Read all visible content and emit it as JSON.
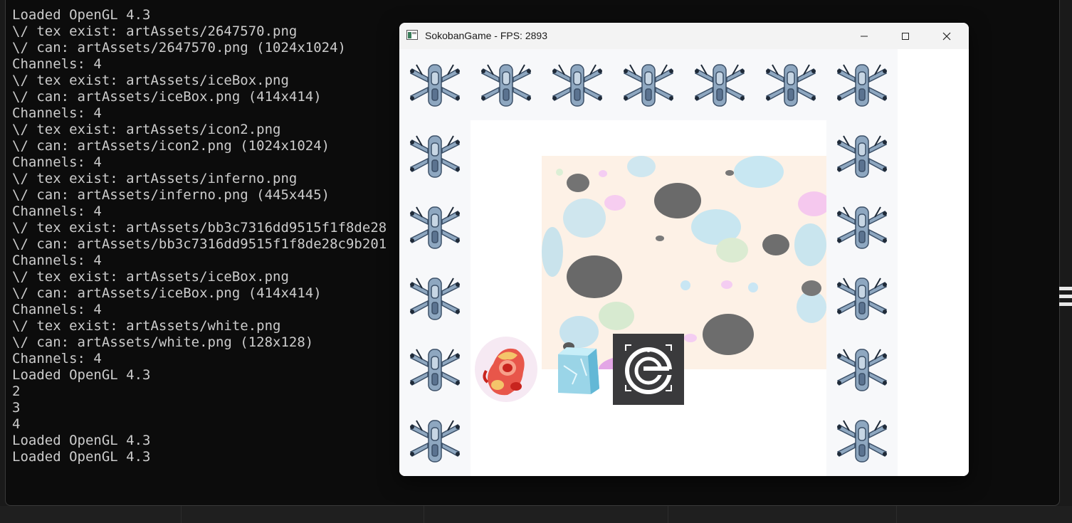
{
  "terminal": {
    "lines": [
      "Loaded OpenGL 4.3",
      "\\/ tex exist: artAssets/2647570.png",
      "\\/ can: artAssets/2647570.png (1024x1024)",
      "Channels: 4",
      "\\/ tex exist: artAssets/iceBox.png",
      "\\/ can: artAssets/iceBox.png (414x414)",
      "Channels: 4",
      "\\/ tex exist: artAssets/icon2.png",
      "\\/ can: artAssets/icon2.png (1024x1024)",
      "Channels: 4",
      "\\/ tex exist: artAssets/inferno.png",
      "\\/ can: artAssets/inferno.png (445x445)",
      "Channels: 4",
      "\\/ tex exist: artAssets/bb3c7316dd9515f1f8de28",
      "\\/ can: artAssets/bb3c7316dd9515f1f8de28c9b201",
      "Channels: 4",
      "\\/ tex exist: artAssets/iceBox.png",
      "\\/ can: artAssets/iceBox.png (414x414)",
      "Channels: 4",
      "\\/ tex exist: artAssets/white.png",
      "\\/ can: artAssets/white.png (128x128)",
      "Channels: 4",
      "Loaded OpenGL 4.3",
      "2",
      "3",
      "4",
      "Loaded OpenGL 4.3",
      "Loaded OpenGL 4.3"
    ]
  },
  "window": {
    "title": "SokobanGame - FPS: 2893",
    "app_icon": "window-app-icon",
    "minimize_icon": "minimize-icon",
    "maximize_icon": "maximize-icon",
    "close_icon": "close-icon"
  },
  "game": {
    "tiles": {
      "wall": "spaceship-wall-icon",
      "player": "inferno-player-icon",
      "box": "ice-box-icon",
      "goal": "goal-target-icon",
      "floor": "speckled-floor"
    },
    "colors": {
      "floor": "#fdf1e6",
      "wall_bg": "#f7f8fa",
      "goal_bg": "#3a3a3c",
      "terminal_bg": "#0c0c0c",
      "terminal_text": "#cccccc"
    }
  }
}
